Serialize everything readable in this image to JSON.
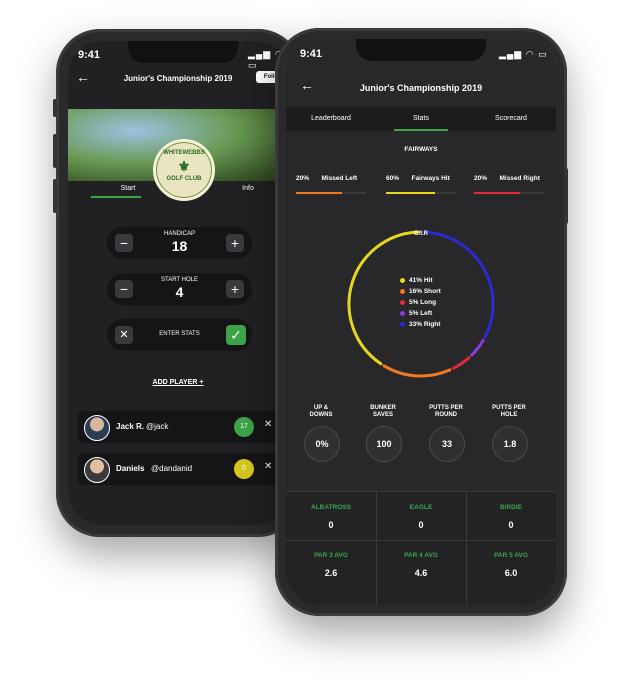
{
  "back": {
    "status_time": "9:41",
    "title": "Junior's Championship 2019",
    "follow_label": "Follo",
    "tabs": [
      {
        "label": "Start"
      },
      {
        "label": "Info"
      }
    ],
    "logo_text_top": "WHITEWEBBS",
    "logo_text_bottom": "GOLF CLUB",
    "handicap": {
      "label": "HANDICAP",
      "value": "18"
    },
    "start_hole": {
      "label": "START HOLE",
      "value": "4"
    },
    "enter_stats_label": "ENTER STATS",
    "add_player_label": "ADD PLAYER +",
    "players": [
      {
        "name": "Jack R.",
        "handle": "@jack",
        "badge": "17",
        "badge_color": "#3ca54a"
      },
      {
        "name": "Daniels",
        "handle": "@dandanid",
        "badge": "0",
        "badge_color": "#d6c81f"
      }
    ]
  },
  "front": {
    "status_time": "9:41",
    "title": "Junior's Championship 2019",
    "tabs": [
      {
        "label": "Leaderboard"
      },
      {
        "label": "Stats",
        "active": true
      },
      {
        "label": "Scorecard"
      }
    ],
    "fairways": {
      "heading": "FAIRWAYS",
      "items": [
        {
          "pct": "20%",
          "label": "Missed Left",
          "color": "#f07a20"
        },
        {
          "pct": "60%",
          "label": "Fairways Hit",
          "color": "#e6d61c"
        },
        {
          "pct": "20%",
          "label": "Missed Right",
          "color": "#e02a3a"
        }
      ]
    },
    "gir": {
      "label": "G.I.R",
      "legend": [
        {
          "text": "41% Hit",
          "color": "#e6d61c",
          "value": 41
        },
        {
          "text": "16% Short",
          "color": "#f07a20",
          "value": 16
        },
        {
          "text": "5% Long",
          "color": "#e02a3a",
          "value": 5
        },
        {
          "text": "5% Left",
          "color": "#8a3ad8",
          "value": 5
        },
        {
          "text": "33% Right",
          "color": "#2a2ad0",
          "value": 33
        }
      ]
    },
    "round_stats": [
      {
        "label1": "UP &",
        "label2": "DOWNS",
        "value": "0%"
      },
      {
        "label1": "BUNKER",
        "label2": "SAVES",
        "value": "100"
      },
      {
        "label1": "PUTTS PER",
        "label2": "ROUND",
        "value": "33"
      },
      {
        "label1": "PUTTS PER",
        "label2": "HOLE",
        "value": "1.8"
      }
    ],
    "grid": [
      {
        "label": "ALBATROSS",
        "value": "0"
      },
      {
        "label": "EAGLE",
        "value": "0"
      },
      {
        "label": "BIRDIE",
        "value": "0"
      },
      {
        "label": "PAR 3 AVG",
        "value": "2.6"
      },
      {
        "label": "PAR 4 AVG",
        "value": "4.6"
      },
      {
        "label": "PAR 5 AVG",
        "value": "6.0"
      }
    ],
    "colors": {
      "accent_green": "#3ca54a",
      "tab_underline": "#3ca54a"
    }
  }
}
